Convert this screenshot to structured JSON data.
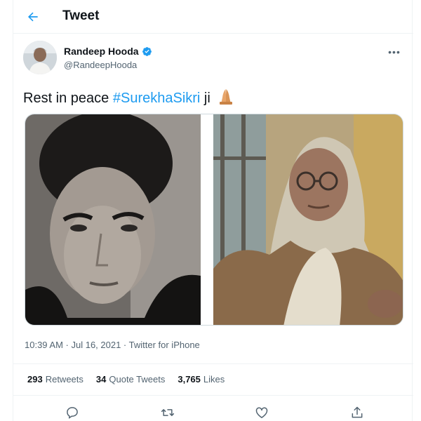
{
  "header": {
    "title": "Tweet",
    "back_icon": "arrow-left-icon",
    "accent": "#1d9bf0"
  },
  "author": {
    "name": "Randeep Hooda",
    "handle": "@RandeepHooda",
    "verified": true
  },
  "tweet": {
    "text_prefix": "Rest in peace ",
    "hashtag": "#SurekhaSikri",
    "text_suffix": " ji",
    "emoji": "folded-hands-emoji"
  },
  "meta": {
    "line": "10:39 AM · Jul 16, 2021 · Twitter for iPhone"
  },
  "stats": {
    "retweets_count": "293",
    "retweets_label": "Retweets",
    "quotes_count": "34",
    "quotes_label": "Quote Tweets",
    "likes_count": "3,765",
    "likes_label": "Likes"
  },
  "actions": [
    "reply-icon",
    "retweet-icon",
    "like-icon",
    "share-icon"
  ]
}
